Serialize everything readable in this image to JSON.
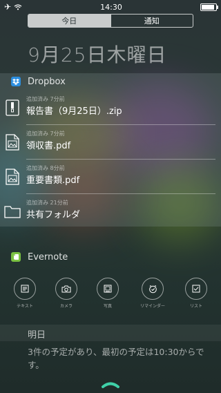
{
  "status_bar": {
    "time": "14:30",
    "airplane_icon": "airplane-icon",
    "wifi_icon": "wifi-icon",
    "battery_icon": "battery-icon",
    "battery_level": 0.9
  },
  "segment": {
    "today_label": "今日",
    "notifications_label": "通知",
    "selected": "today"
  },
  "date_heading": "9月25日木曜日",
  "dropbox": {
    "title": "Dropbox",
    "icon": "dropbox-icon",
    "accent": "#2d8fe0",
    "files": [
      {
        "meta": "追加済み 7分前",
        "name": "報告書（9月25日）.zip",
        "icon": "zip-file-icon"
      },
      {
        "meta": "追加済み 7分前",
        "name": "領収書.pdf",
        "icon": "image-file-icon"
      },
      {
        "meta": "追加済み 8分前",
        "name": "重要書類.pdf",
        "icon": "image-file-icon"
      },
      {
        "meta": "追加済み 21分前",
        "name": "共有フォルダ",
        "icon": "folder-icon"
      }
    ]
  },
  "evernote": {
    "title": "Evernote",
    "icon": "evernote-icon",
    "accent": "#7ac142",
    "actions": [
      {
        "label": "テキスト",
        "icon": "text-note-icon"
      },
      {
        "label": "カメラ",
        "icon": "camera-icon"
      },
      {
        "label": "写真",
        "icon": "photo-icon"
      },
      {
        "label": "リマインダー",
        "icon": "reminder-icon"
      },
      {
        "label": "リスト",
        "icon": "checklist-icon"
      }
    ]
  },
  "tomorrow": {
    "heading": "明日",
    "summary": "3件の予定があり、最初の予定は10:30からです。"
  }
}
